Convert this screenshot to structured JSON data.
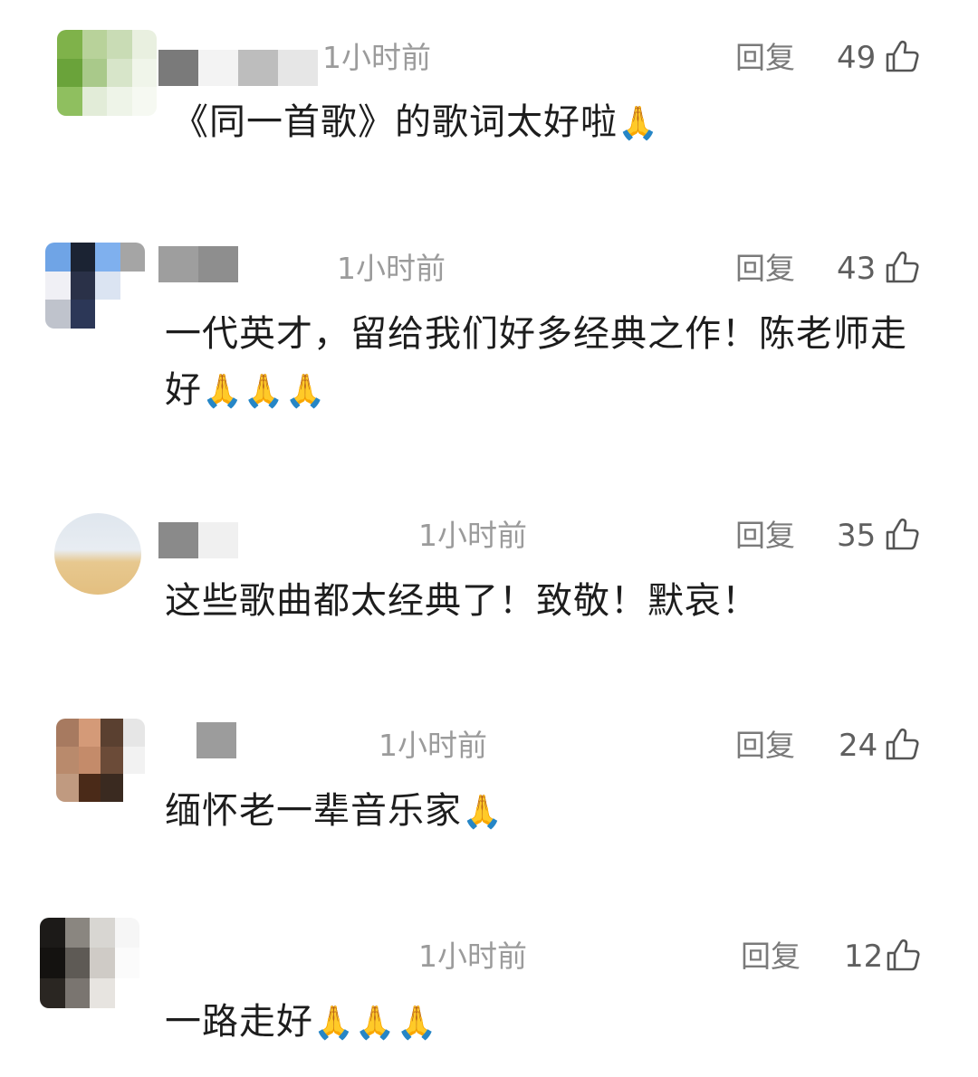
{
  "comments": [
    {
      "time": "1小时前",
      "reply_label": "回复",
      "likes": "49",
      "text": "《同一首歌》的歌词太好啦",
      "emoji": "🙏"
    },
    {
      "time": "1小时前",
      "reply_label": "回复",
      "likes": "43",
      "text": "一代英才，留给我们好多经典之作！陈老师走好",
      "emoji": "🙏🙏🙏"
    },
    {
      "time": "1小时前",
      "reply_label": "回复",
      "likes": "35",
      "text": "这些歌曲都太经典了！致敬！默哀！",
      "emoji": ""
    },
    {
      "time": "1小时前",
      "reply_label": "回复",
      "likes": "24",
      "text": "缅怀老一辈音乐家",
      "emoji": "🙏"
    },
    {
      "time": "1小时前",
      "reply_label": "回复",
      "likes": "12",
      "text": "一路走好",
      "emoji": "🙏🙏🙏"
    }
  ],
  "icons": {
    "like": "thumbs-up-icon",
    "emoji": "folded-hands-emoji"
  },
  "colors": {
    "text": "#1d1d1d",
    "meta": "#9b9b9b",
    "reply": "#7a7a7a"
  }
}
